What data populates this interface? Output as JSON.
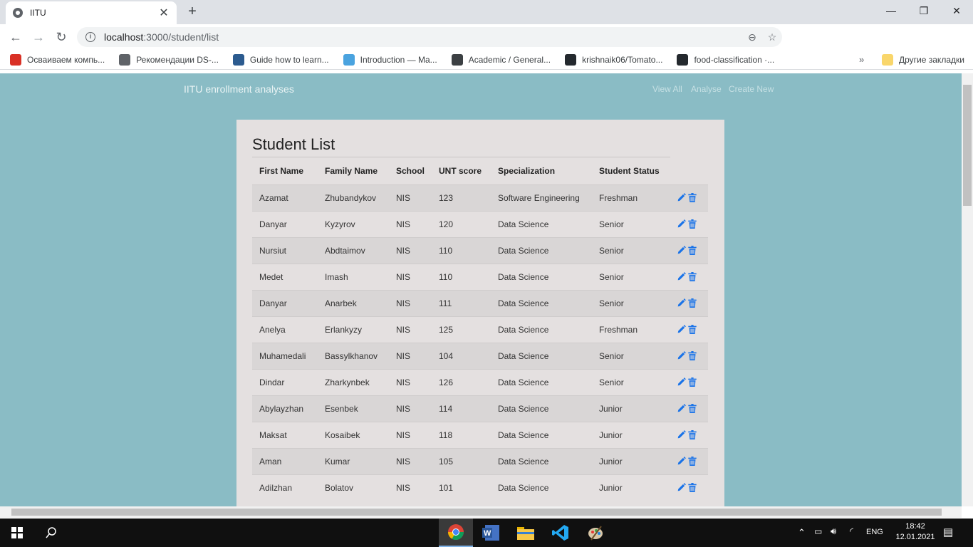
{
  "browser": {
    "tab_title": "IITU",
    "url_host": "localhost",
    "url_path": ":3000/student/list",
    "bookmarks": [
      {
        "label": "Осваиваем компь...",
        "color": "#d93025"
      },
      {
        "label": "Рекомендации DS-...",
        "color": "#5f6368"
      },
      {
        "label": "Guide how to learn...",
        "color": "#2c5b8f"
      },
      {
        "label": "Introduction — Ma...",
        "color": "#4aa3df"
      },
      {
        "label": "Academic / General...",
        "color": "#3c4043"
      },
      {
        "label": "krishnaik06/Tomato...",
        "color": "#24292e"
      },
      {
        "label": "food-classification ·...",
        "color": "#24292e"
      }
    ],
    "other_bookmarks": "Другие закладки"
  },
  "app": {
    "brand": "IITU enrollment analyses",
    "nav": [
      "View All",
      "Analyse",
      "Create New"
    ],
    "page_title": "Student List",
    "columns": [
      "First Name",
      "Family Name",
      "School",
      "UNT score",
      "Specialization",
      "Student Status"
    ],
    "rows": [
      {
        "first": "Azamat",
        "family": "Zhubandykov",
        "school": "NIS",
        "unt": "123",
        "spec": "Software Engineering",
        "status": "Freshman"
      },
      {
        "first": "Danyar",
        "family": "Kyzyrov",
        "school": "NIS",
        "unt": "120",
        "spec": "Data Science",
        "status": "Senior"
      },
      {
        "first": "Nursiut",
        "family": "Abdtaimov",
        "school": "NIS",
        "unt": "110",
        "spec": "Data Science",
        "status": "Senior"
      },
      {
        "first": "Medet",
        "family": "Imash",
        "school": "NIS",
        "unt": "110",
        "spec": "Data Science",
        "status": "Senior"
      },
      {
        "first": "Danyar",
        "family": "Anarbek",
        "school": "NIS",
        "unt": "111",
        "spec": "Data Science",
        "status": "Senior"
      },
      {
        "first": "Anelya",
        "family": "Erlankyzy",
        "school": "NIS",
        "unt": "125",
        "spec": "Data Science",
        "status": "Freshman"
      },
      {
        "first": "Muhamedali",
        "family": "Bassylkhanov",
        "school": "NIS",
        "unt": "104",
        "spec": "Data Science",
        "status": "Senior"
      },
      {
        "first": "Dindar",
        "family": "Zharkynbek",
        "school": "NIS",
        "unt": "126",
        "spec": "Data Science",
        "status": "Senior"
      },
      {
        "first": "Abylayzhan",
        "family": "Esenbek",
        "school": "NIS",
        "unt": "114",
        "spec": "Data Science",
        "status": "Junior"
      },
      {
        "first": "Maksat",
        "family": "Kosaibek",
        "school": "NIS",
        "unt": "118",
        "spec": "Data Science",
        "status": "Junior"
      },
      {
        "first": "Aman",
        "family": "Kumar",
        "school": "NIS",
        "unt": "105",
        "spec": "Data Science",
        "status": "Junior"
      },
      {
        "first": "Adilzhan",
        "family": "Bolatov",
        "school": "NIS",
        "unt": "101",
        "spec": "Data Science",
        "status": "Junior"
      }
    ],
    "colors": {
      "background": "#8abcc5",
      "card": "#e4e0e0",
      "action": "#1a73e8"
    }
  },
  "taskbar": {
    "language": "ENG",
    "time": "18:42",
    "date": "12.01.2021"
  }
}
